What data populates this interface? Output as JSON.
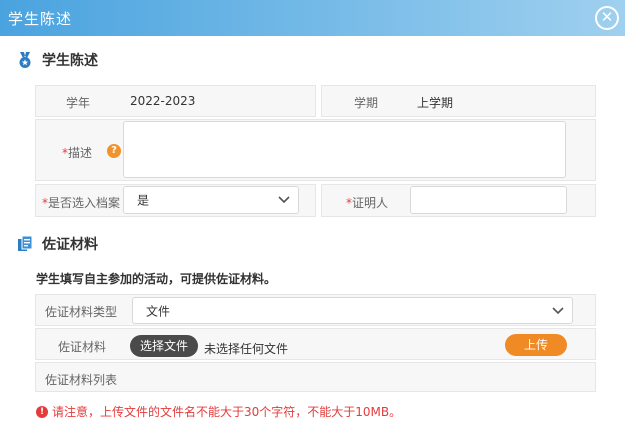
{
  "window": {
    "title": "学生陈述",
    "close_icon": "close-circle-icon"
  },
  "section1": {
    "title": "学生陈述",
    "icon": "medal-icon",
    "year_label": "学年",
    "year_value": "2022-2023",
    "term_label": "学期",
    "term_value": "上学期",
    "desc_label": "描述",
    "desc_value": "",
    "archive_label": "是否选入档案",
    "archive_value": "是",
    "witness_label": "证明人",
    "witness_value": "",
    "required_mark": "*"
  },
  "section2": {
    "title": "佐证材料",
    "icon": "document-icon",
    "note": "学生填写自主参加的活动，可提供佐证材料。",
    "type_label": "佐证材料类型",
    "type_value": "文件",
    "material_label": "佐证材料",
    "choose_file_label": "选择文件",
    "file_status": "未选择任何文件",
    "upload_label": "上传",
    "list_label": "佐证材料列表"
  },
  "warning": "请注意，上传文件的文件名不能大于30个字符，不能大于10MB。",
  "colors": {
    "title_bar": "#4aa3df",
    "accent_orange": "#f08a24",
    "danger_red": "#e43b3b"
  }
}
